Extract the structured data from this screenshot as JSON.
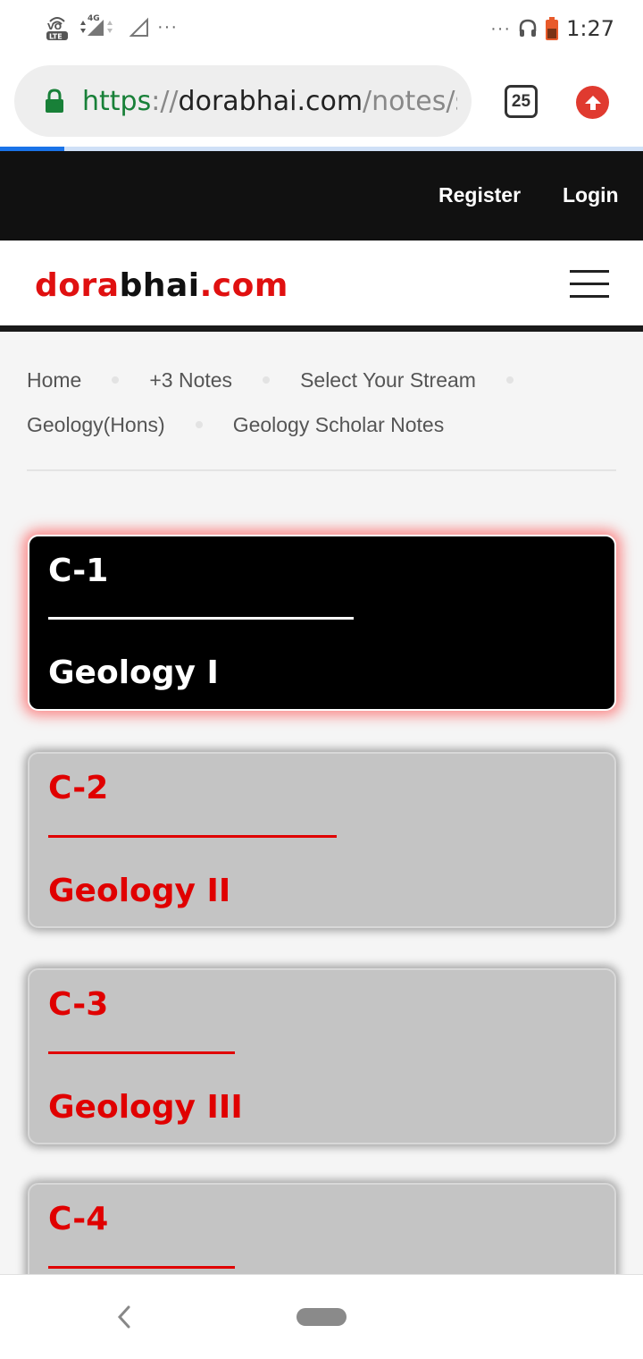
{
  "status_bar": {
    "volte_label": "VoLTE",
    "network_label": "4G",
    "more_left": "···",
    "more_right": "···",
    "time": "1:27"
  },
  "browser": {
    "url_scheme": "https",
    "url_sep": "://",
    "url_host": "dorabhai.com",
    "url_path": "/notes/s",
    "tab_count": "25"
  },
  "top_nav": {
    "register": "Register",
    "login": "Login"
  },
  "header": {
    "logo_part1": "dora",
    "logo_part2": "bhai",
    "logo_part3": ".com"
  },
  "breadcrumb": {
    "row1": [
      "Home",
      "+3 Notes",
      "Select Your Stream"
    ],
    "row2": [
      "Geology(Hons)",
      "Geology Scholar Notes"
    ]
  },
  "cards": [
    {
      "code": "C-1",
      "title": "Geology I",
      "active": true
    },
    {
      "code": "C-2",
      "title": "Geology II",
      "active": false
    },
    {
      "code": "C-3",
      "title": "Geology III",
      "active": false
    },
    {
      "code": "C-4",
      "title": "",
      "active": false
    }
  ],
  "colors": {
    "accent_red": "#e00000",
    "nav_dark": "#111111",
    "card_inactive": "#c4c4c4",
    "card_active": "#000000"
  }
}
